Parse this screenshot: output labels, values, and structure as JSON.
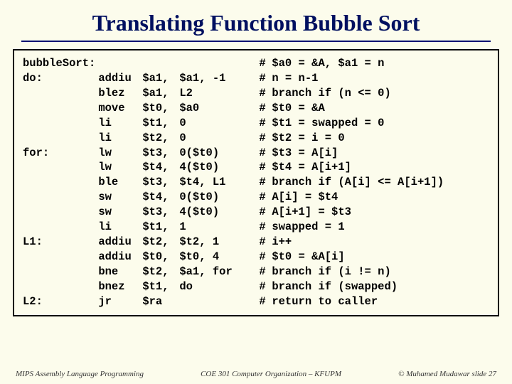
{
  "title": "Translating Function Bubble Sort",
  "code": {
    "rows": [
      {
        "label": "bubbleSort:",
        "instr": "",
        "reg": "",
        "arg": "",
        "comment": "$a0 = &A, $a1 = n"
      },
      {
        "label": "do:",
        "instr": "addiu",
        "reg": "$a1,",
        "arg": "$a1, -1",
        "comment": "n = n-1"
      },
      {
        "label": "",
        "instr": "blez",
        "reg": "$a1,",
        "arg": "L2",
        "comment": "branch if (n <= 0)"
      },
      {
        "label": "",
        "instr": "move",
        "reg": "$t0,",
        "arg": "$a0",
        "comment": "$t0 = &A"
      },
      {
        "label": "",
        "instr": "li",
        "reg": "$t1,",
        "arg": "0",
        "comment": "$t1 = swapped = 0"
      },
      {
        "label": "",
        "instr": "li",
        "reg": "$t2,",
        "arg": "0",
        "comment": "$t2 = i = 0"
      },
      {
        "label": "for:",
        "instr": "lw",
        "reg": "$t3,",
        "arg": "0($t0)",
        "comment": "$t3 = A[i]"
      },
      {
        "label": "",
        "instr": "lw",
        "reg": "$t4,",
        "arg": "4($t0)",
        "comment": "$t4 = A[i+1]"
      },
      {
        "label": "",
        "instr": "ble",
        "reg": "$t3,",
        "arg": "$t4, L1",
        "comment": "branch if (A[i] <= A[i+1])"
      },
      {
        "label": "",
        "instr": "sw",
        "reg": "$t4,",
        "arg": "0($t0)",
        "comment": "A[i] = $t4"
      },
      {
        "label": "",
        "instr": "sw",
        "reg": "$t3,",
        "arg": "4($t0)",
        "comment": "A[i+1] = $t3"
      },
      {
        "label": "",
        "instr": "li",
        "reg": "$t1,",
        "arg": "1",
        "comment": "swapped = 1"
      },
      {
        "label": "L1:",
        "instr": "addiu",
        "reg": "$t2,",
        "arg": "$t2, 1",
        "comment": "i++"
      },
      {
        "label": "",
        "instr": "addiu",
        "reg": "$t0,",
        "arg": "$t0, 4",
        "comment": "$t0 = &A[i]"
      },
      {
        "label": "",
        "instr": "bne",
        "reg": "$t2,",
        "arg": "$a1, for",
        "comment": "branch if (i != n)"
      },
      {
        "label": "",
        "instr": "bnez",
        "reg": "$t1,",
        "arg": "do",
        "comment": "branch if (swapped)"
      },
      {
        "label": "L2:",
        "instr": "jr",
        "reg": "$ra",
        "arg": "",
        "comment": "return to caller"
      }
    ]
  },
  "footer": {
    "left": "MIPS Assembly Language Programming",
    "center": "COE 301 Computer Organization – KFUPM",
    "right": "© Muhamed Mudawar   slide 27"
  }
}
